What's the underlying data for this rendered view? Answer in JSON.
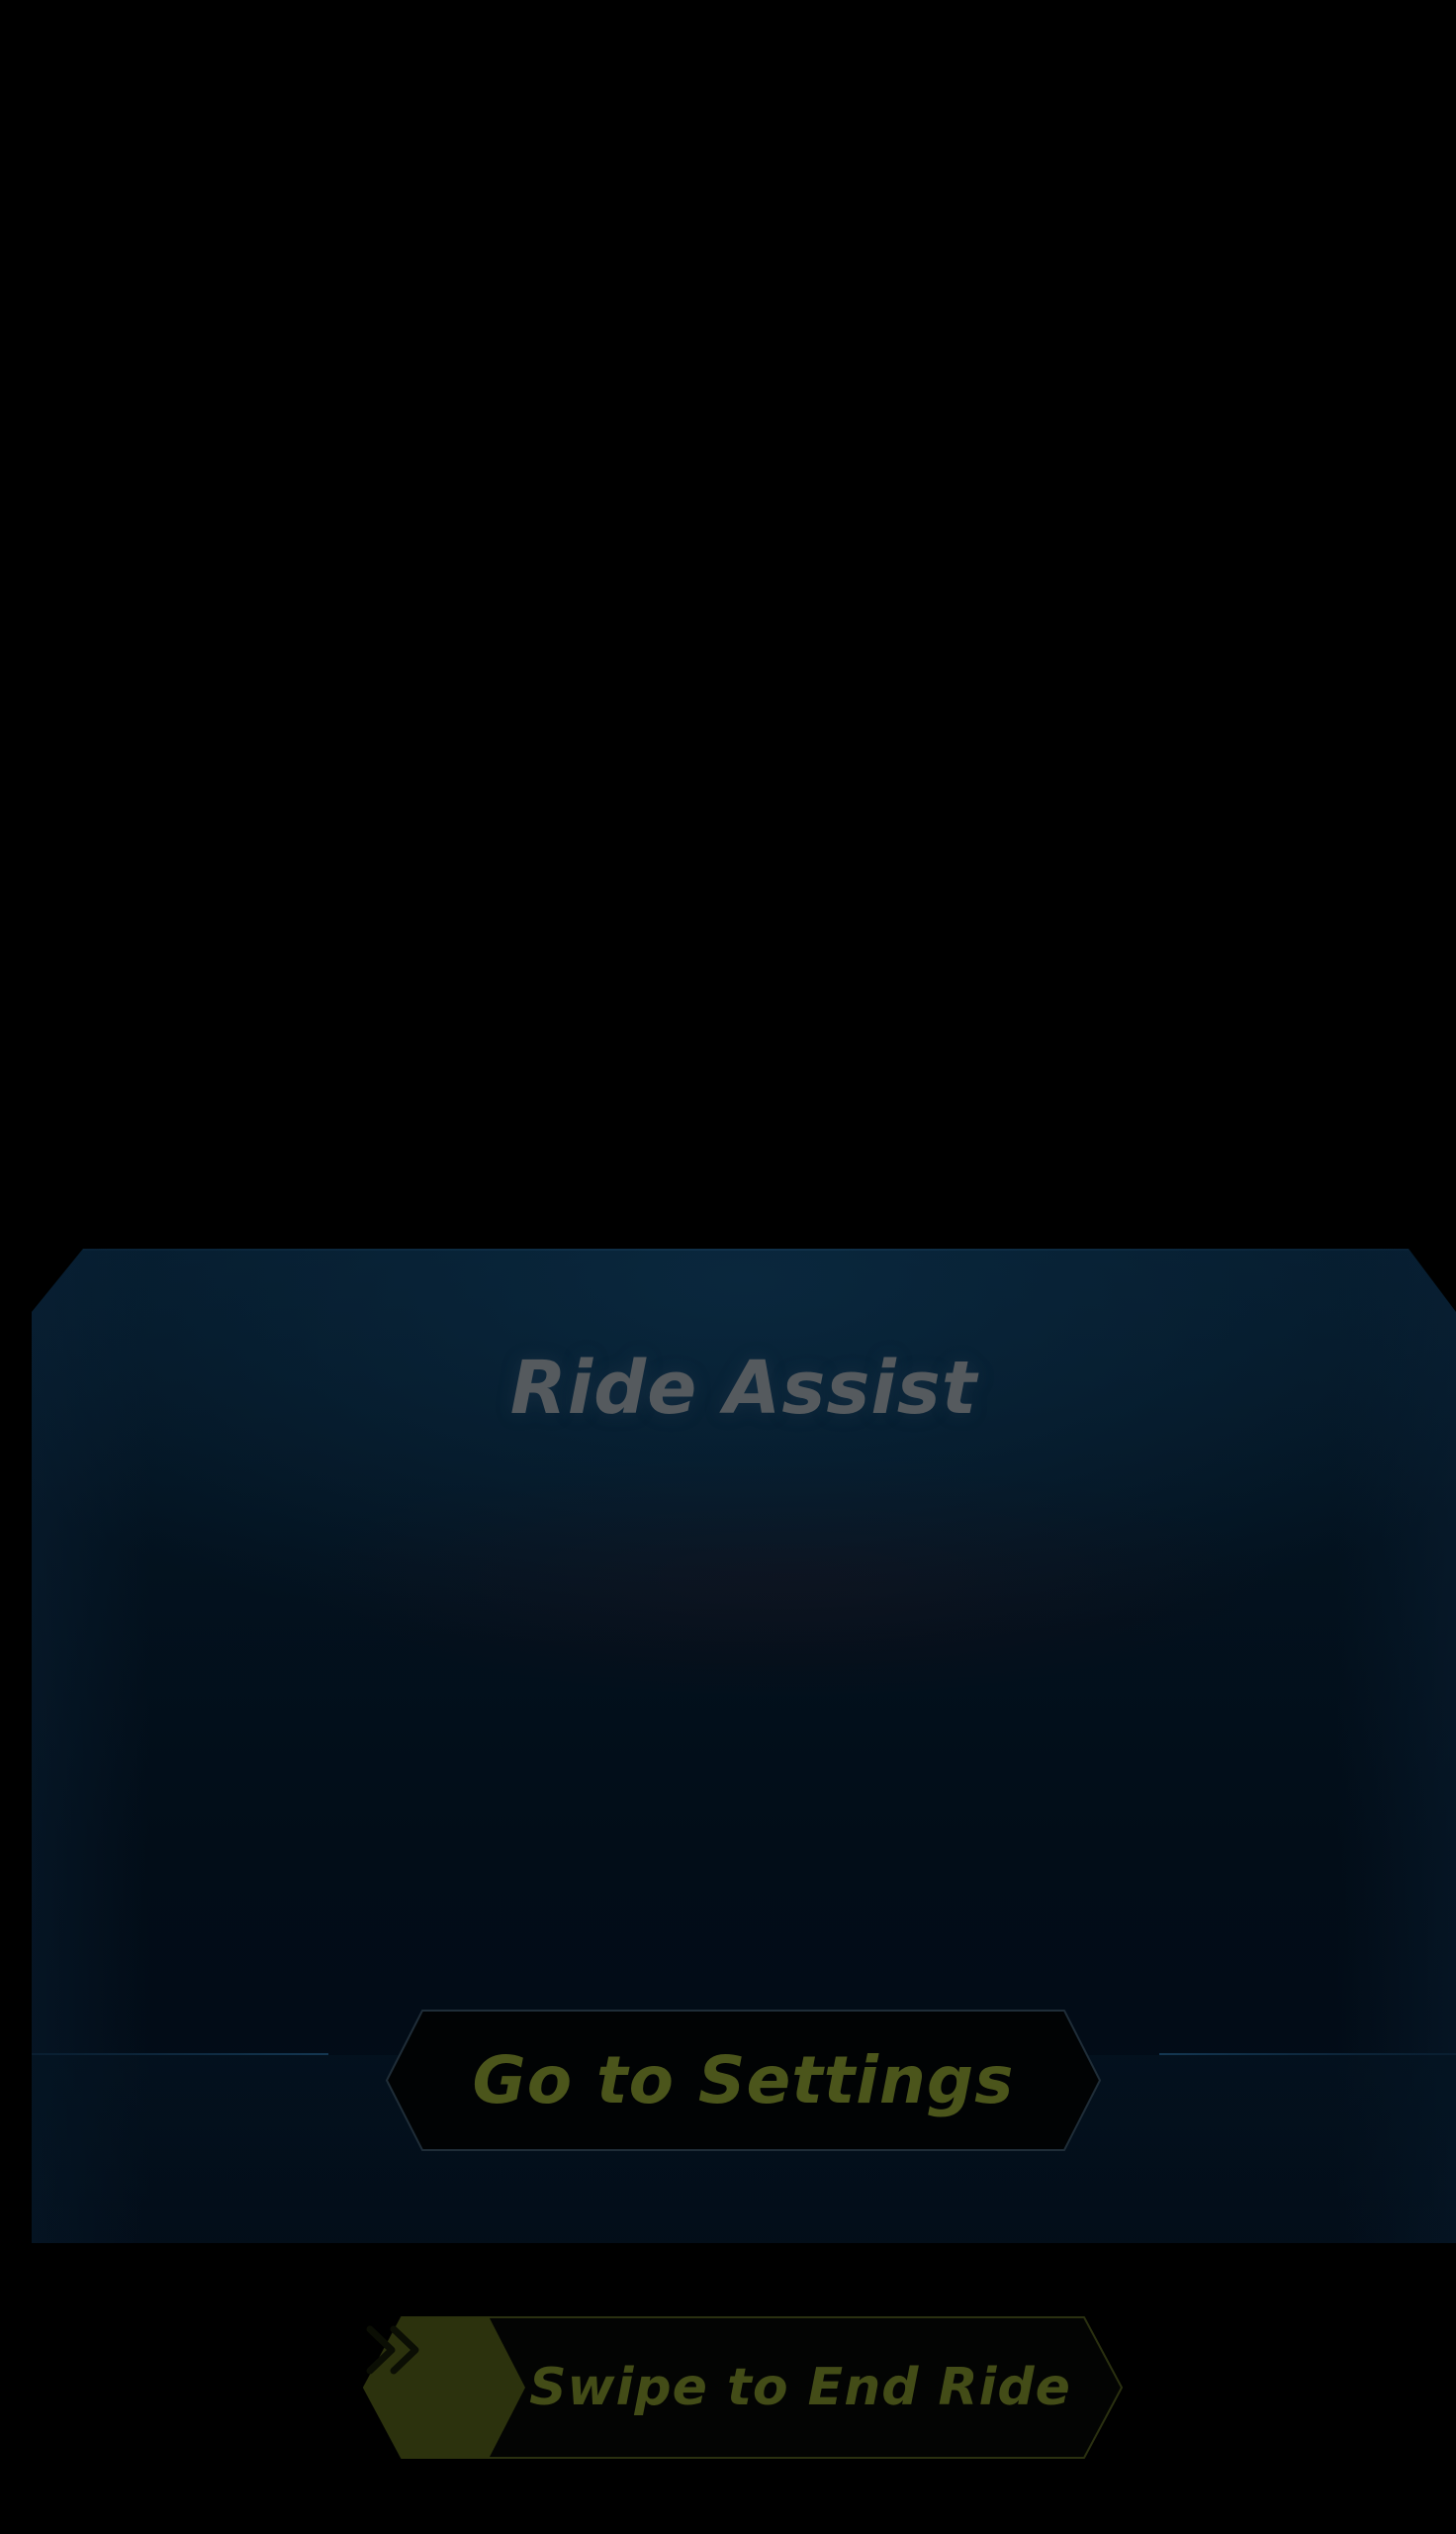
{
  "ride_assist": {
    "title": "Ride Assist",
    "settings_button_label": "Go to Settings"
  },
  "end_ride_slider": {
    "label": "Swipe to End Ride",
    "handle_icon": "double-chevron-right-icon",
    "progress": 0
  },
  "colors": {
    "background": "#000000",
    "panel": "#03121f",
    "title_text": "#555a5e",
    "accent": "#4b551b",
    "slider_handle": "#2c320d"
  }
}
